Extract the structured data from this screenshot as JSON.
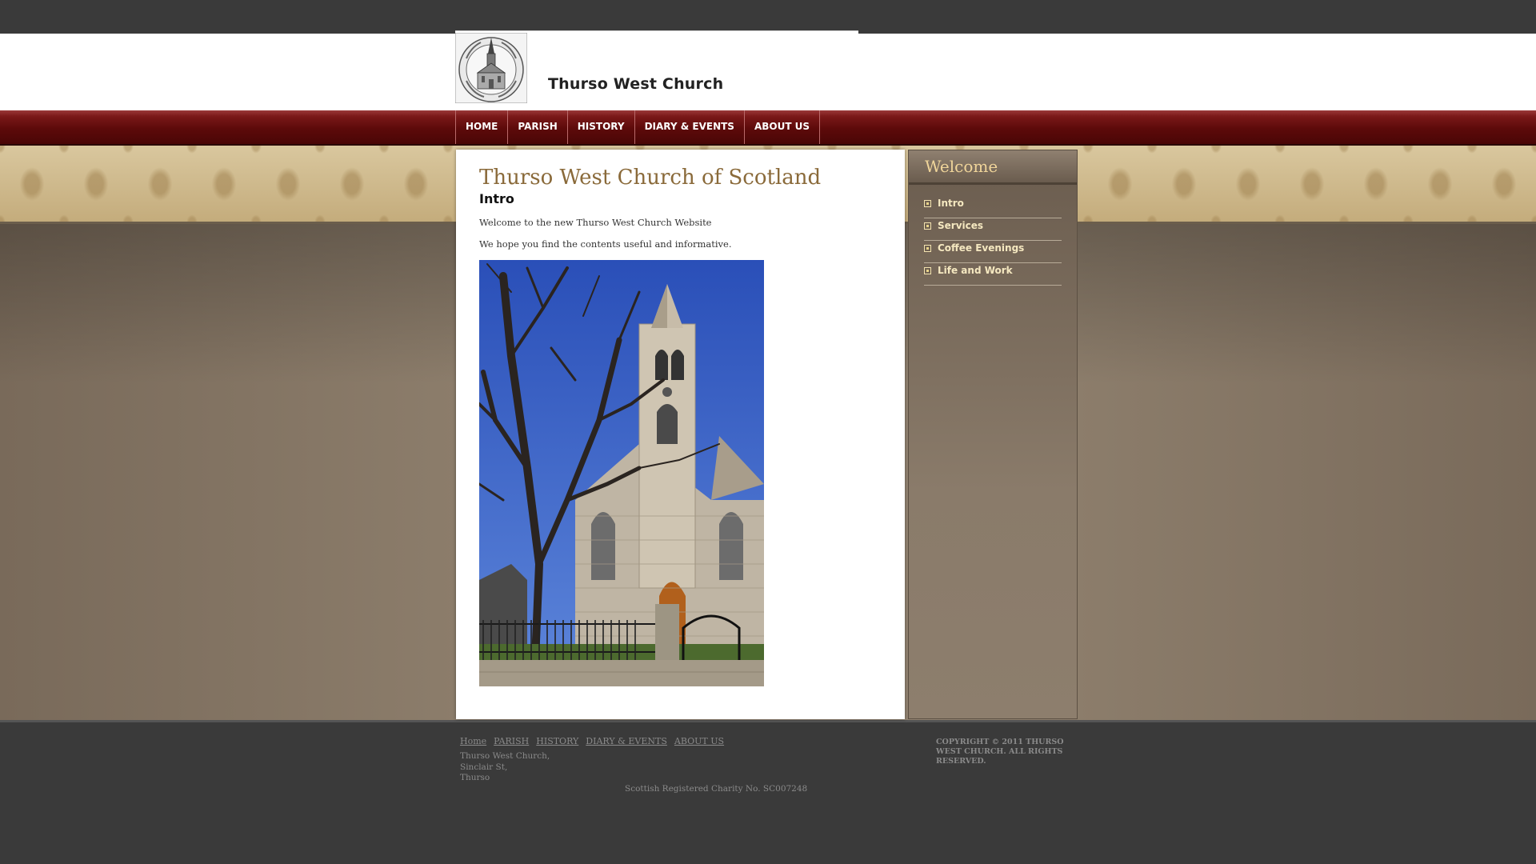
{
  "header": {
    "site_title": "Thurso West Church",
    "logo_icon": "church-seal-logo"
  },
  "nav": {
    "items": [
      {
        "label": "HOME"
      },
      {
        "label": "PARISH"
      },
      {
        "label": "HISTORY"
      },
      {
        "label": "DIARY & EVENTS"
      },
      {
        "label": "ABOUT US"
      }
    ]
  },
  "main": {
    "title": "Thurso West Church of Scotland",
    "subtitle": "Intro",
    "paragraphs": [
      "Welcome to the new Thurso West Church Website",
      "We hope you find the contents useful and informative."
    ],
    "photo_icon": "church-photo"
  },
  "sidebar": {
    "title": "Welcome",
    "items": [
      {
        "label": "Intro"
      },
      {
        "label": "Services"
      },
      {
        "label": "Coffee Evenings"
      },
      {
        "label": "Life and Work"
      }
    ]
  },
  "footer": {
    "nav": [
      {
        "label": "Home"
      },
      {
        "label": "PARISH"
      },
      {
        "label": "HISTORY"
      },
      {
        "label": "DIARY & EVENTS"
      },
      {
        "label": "ABOUT US"
      }
    ],
    "address": [
      "Thurso West Church,",
      "Sinclair St,",
      "Thurso"
    ],
    "charity": "Scottish Registered Charity No. SC007248",
    "copyright": "COPYRIGHT © 2011 THURSO WEST CHURCH. ALL RIGHTS RESERVED."
  },
  "colors": {
    "nav_red": "#5c0a0a",
    "title_brown": "#8a6a3a",
    "sidebar_gold": "#f0d59a"
  }
}
